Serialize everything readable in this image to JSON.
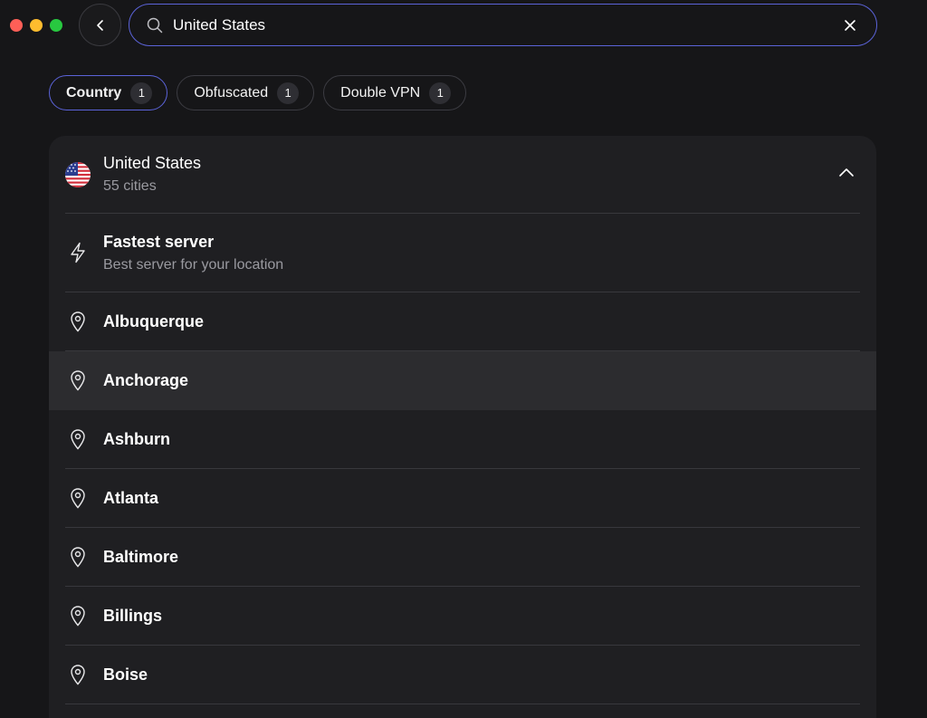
{
  "search": {
    "value": "United States",
    "placeholder": ""
  },
  "filters": [
    {
      "label": "Country",
      "count": "1",
      "active": true
    },
    {
      "label": "Obfuscated",
      "count": "1",
      "active": false
    },
    {
      "label": "Double VPN",
      "count": "1",
      "active": false
    }
  ],
  "country": {
    "name": "United States",
    "subtitle": "55 cities",
    "flag": "us-flag-icon"
  },
  "fastest": {
    "title": "Fastest server",
    "subtitle": "Best server for your location"
  },
  "cities": [
    "Albuquerque",
    "Anchorage",
    "Ashburn",
    "Atlanta",
    "Baltimore",
    "Billings",
    "Boise"
  ],
  "colors": {
    "accent": "#5b63d8",
    "panel": "#1f1f22",
    "background": "#161618",
    "hover": "#2c2c2f"
  }
}
